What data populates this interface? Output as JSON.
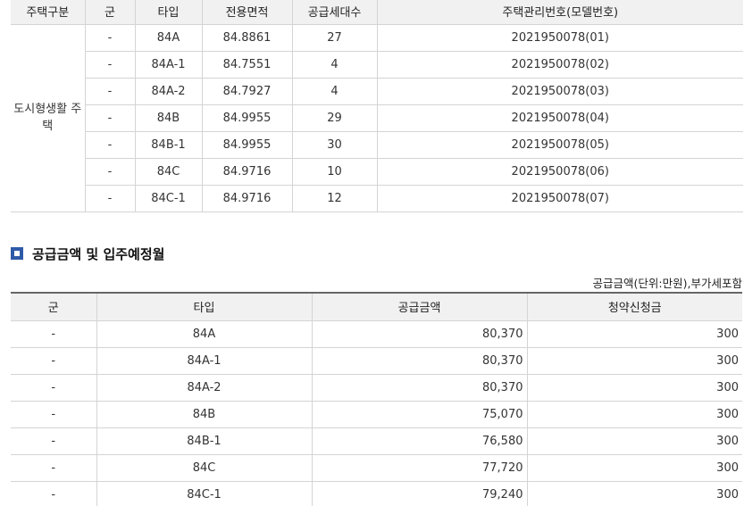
{
  "housing": {
    "headers": [
      "주택구분",
      "군",
      "타입",
      "전용면적",
      "공급세대수",
      "주택관리번호(모델번호)"
    ],
    "kind": "도시형생활 주택",
    "rows": [
      {
        "group": "-",
        "type": "84A",
        "area": "84.8861",
        "units": "27",
        "code": "2021950078(01)"
      },
      {
        "group": "-",
        "type": "84A-1",
        "area": "84.7551",
        "units": "4",
        "code": "2021950078(02)"
      },
      {
        "group": "-",
        "type": "84A-2",
        "area": "84.7927",
        "units": "4",
        "code": "2021950078(03)"
      },
      {
        "group": "-",
        "type": "84B",
        "area": "84.9955",
        "units": "29",
        "code": "2021950078(04)"
      },
      {
        "group": "-",
        "type": "84B-1",
        "area": "84.9955",
        "units": "30",
        "code": "2021950078(05)"
      },
      {
        "group": "-",
        "type": "84C",
        "area": "84.9716",
        "units": "10",
        "code": "2021950078(06)"
      },
      {
        "group": "-",
        "type": "84C-1",
        "area": "84.9716",
        "units": "12",
        "code": "2021950078(07)"
      }
    ]
  },
  "section": {
    "title": "공급금액 및 입주예정월",
    "unit_note": "공급금액(단위:만원),부가세포함",
    "accent_color": "#2e5aa8"
  },
  "price": {
    "headers": [
      "군",
      "타입",
      "공급금액",
      "청약신청금"
    ],
    "rows": [
      {
        "group": "-",
        "type": "84A",
        "price": "80,370",
        "deposit": "300"
      },
      {
        "group": "-",
        "type": "84A-1",
        "price": "80,370",
        "deposit": "300"
      },
      {
        "group": "-",
        "type": "84A-2",
        "price": "80,370",
        "deposit": "300"
      },
      {
        "group": "-",
        "type": "84B",
        "price": "75,070",
        "deposit": "300"
      },
      {
        "group": "-",
        "type": "84B-1",
        "price": "76,580",
        "deposit": "300"
      },
      {
        "group": "-",
        "type": "84C",
        "price": "77,720",
        "deposit": "300"
      },
      {
        "group": "-",
        "type": "84C-1",
        "price": "79,240",
        "deposit": "300"
      }
    ]
  }
}
